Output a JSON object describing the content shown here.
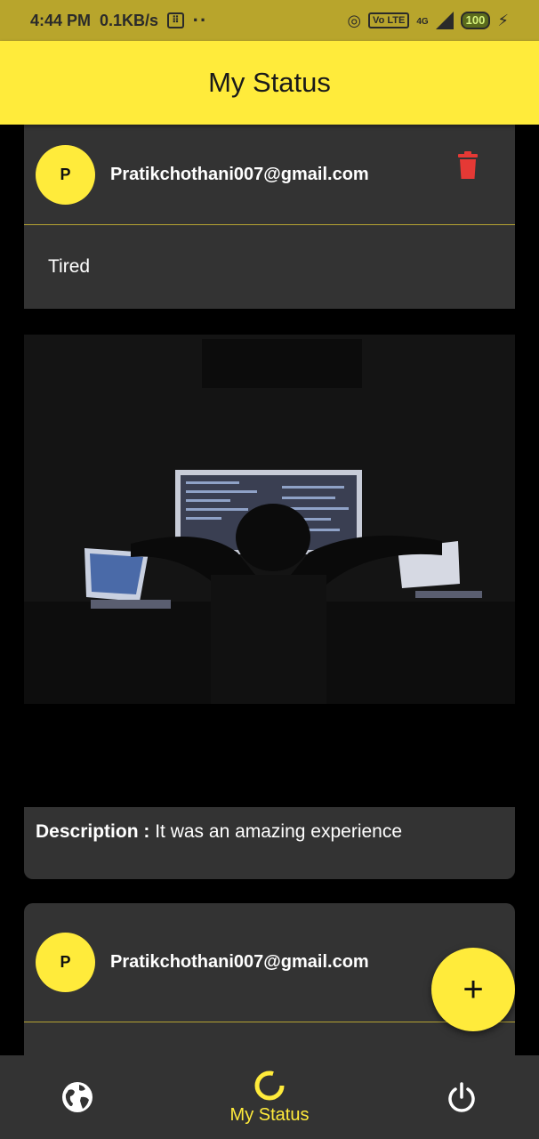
{
  "status_bar": {
    "time": "4:44 PM",
    "speed": "0.1KB/s",
    "dots": "··",
    "volte": "Vo LTE",
    "network": "4G",
    "battery": "100"
  },
  "app_bar": {
    "title": "My Status"
  },
  "posts": [
    {
      "avatar_letter": "P",
      "email": "Pratikchothani007@gmail.com",
      "status": "Tired",
      "description_label": "Description :",
      "description": "It was an amazing experience"
    },
    {
      "avatar_letter": "P",
      "email": "Pratikchothani007@gmail.com"
    }
  ],
  "fab": {
    "icon": "plus-icon",
    "label": "+"
  },
  "bottom_nav": {
    "items": [
      {
        "icon": "globe-icon"
      },
      {
        "icon": "circle-progress-icon",
        "label": "My Status"
      },
      {
        "icon": "power-icon"
      }
    ]
  },
  "colors": {
    "accent": "#ffeb3b",
    "card": "#333333",
    "delete": "#e53935",
    "status_bar": "#b8a52c"
  }
}
